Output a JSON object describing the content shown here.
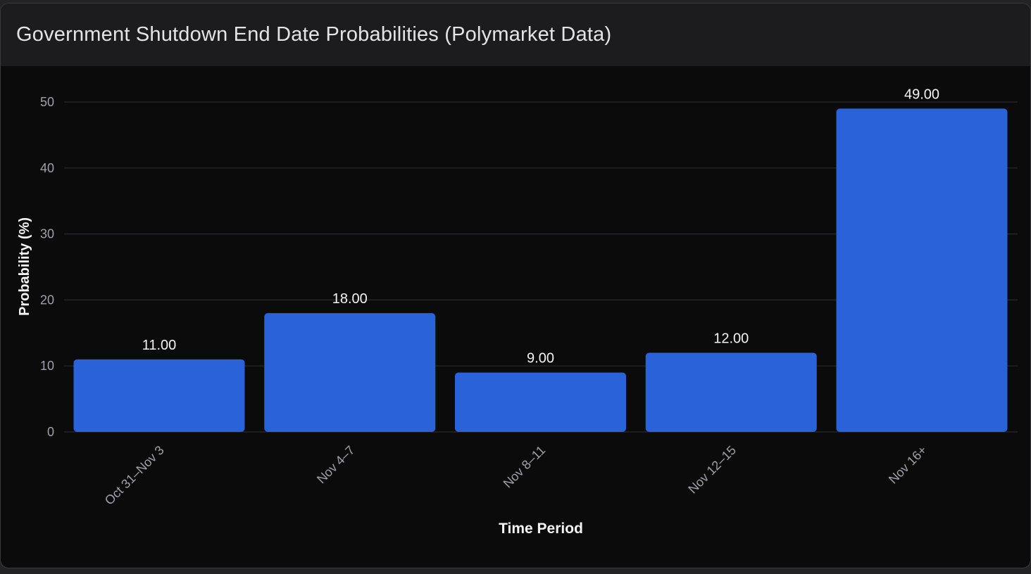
{
  "header": {
    "title": "Government Shutdown End Date Probabilities (Polymarket Data)"
  },
  "colors": {
    "bar": "#2962d9",
    "grid": "#2a2a2d",
    "tick_text": "#a1a1aa",
    "label_text": "#f4f4f5",
    "value_text": "#f4f4f5"
  },
  "chart_data": {
    "type": "bar",
    "categories": [
      "Oct 31–Nov 3",
      "Nov 4–7",
      "Nov 8–11",
      "Nov 12–15",
      "Nov 16+"
    ],
    "values": [
      11.0,
      18.0,
      9.0,
      12.0,
      49.0
    ],
    "value_labels": [
      "11.00",
      "18.00",
      "9.00",
      "12.00",
      "49.00"
    ],
    "title": "Government Shutdown End Date Probabilities (Polymarket Data)",
    "xlabel": "Time Period",
    "ylabel": "Probability (%)",
    "ylim": [
      0,
      50
    ],
    "yticks": [
      0,
      10,
      20,
      30,
      40,
      50
    ],
    "grid": true,
    "legend": "none"
  }
}
